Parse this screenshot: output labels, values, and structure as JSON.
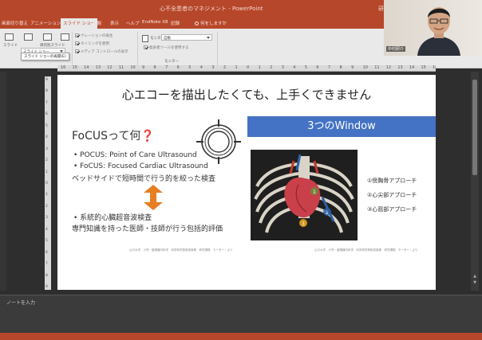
{
  "window": {
    "title": "心不全患者のマネジメント - PowerPoint",
    "user": "研介"
  },
  "tabs": [
    {
      "label": "画面切り替え"
    },
    {
      "label": "アニメーション"
    },
    {
      "label": "スライド ショー",
      "active": true
    },
    {
      "label": "校閲"
    },
    {
      "label": "表示"
    },
    {
      "label": "ヘルプ"
    },
    {
      "label": "EndNote X8"
    },
    {
      "label": "記録"
    },
    {
      "label": "何をしますか"
    }
  ],
  "ribbon": {
    "current_slide_label": "スライド",
    "custom_slide_label": "目的別スライド",
    "custom_slide_button_label": "スライド ショー",
    "custom_slide_menu_item": "スライド ショーの再開(E)",
    "options": [
      {
        "label": "ナレーションの再生",
        "checked": true
      },
      {
        "label": "タイミングを使用",
        "checked": true
      },
      {
        "label": "メディア コントロールの表示",
        "checked": true
      }
    ],
    "monitor_label": "モニター:",
    "monitor_value": "自動",
    "presenter_view_label": "発表者ツールを使用する",
    "presenter_view_checked": true,
    "monitors_group_label": "モニター"
  },
  "ruler_top": [
    "16",
    "15",
    "14",
    "13",
    "12",
    "11",
    "10",
    "9",
    "8",
    "7",
    "6",
    "5",
    "4",
    "3",
    "2",
    "1",
    "0",
    "1",
    "2",
    "3",
    "4",
    "5",
    "6",
    "7",
    "8",
    "9",
    "10",
    "11",
    "12",
    "13",
    "14",
    "15",
    "16"
  ],
  "ruler_left": [
    "9",
    "8",
    "7",
    "6",
    "5",
    "4",
    "3",
    "2",
    "1",
    "0",
    "1",
    "2",
    "3",
    "4",
    "5",
    "6",
    "7",
    "8",
    "9"
  ],
  "slide": {
    "title": "心エコーを描出したくても、上手くできません",
    "question": "FoCUSって何",
    "question_mark": "❓",
    "bullets_top": [
      "• POCUS: Point of Care Ultrasound",
      "• FoCUS: Focused Cardiac Ultrasound"
    ],
    "bedside_line": "ベッドサイドで短時間で行う的を絞った検査",
    "bullet_bottom": "• 系統的心臓超音波検査",
    "expert_line": "専門知識を持った医師・技師が行う包括的評価",
    "window_banner": "3つのWindow",
    "approaches": [
      "①傍胸骨アプローチ",
      "②心尖部アプローチ",
      "③心窩部アプローチ"
    ],
    "footer_left": "山口大学　小児・循環器内科学　科学研究費助成事業　研究課題　モーター・より",
    "footer_right": "山口大学　小児・循環器内科学　科学研究費助成事業　研究課題　モーター・より",
    "heart_labels": [
      "1",
      "2",
      "3"
    ]
  },
  "notes": {
    "placeholder": "ノートを入力"
  },
  "webcam": {
    "name": "中村研介"
  },
  "colors": {
    "accent": "#b7472a",
    "banner": "#4472c4",
    "arrow": "#e67e22"
  }
}
